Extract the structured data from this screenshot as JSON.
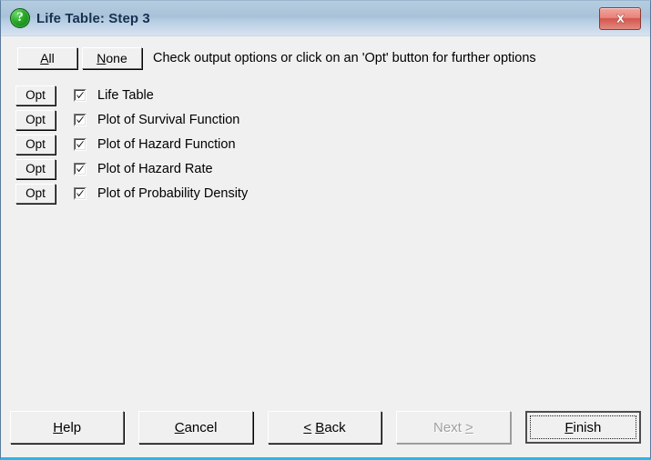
{
  "window": {
    "title": "Life Table: Step 3",
    "icon": "question-mark-icon",
    "close_label": "x",
    "accent_bottom": "#29b6e8",
    "titlebar_color": "#a9c2d9"
  },
  "toolbar": {
    "all_label": "All",
    "all_accel": "A",
    "none_label": "None",
    "none_accel": "N",
    "hint": "Check output options or click on an 'Opt' button for further options"
  },
  "options": {
    "opt_button_label": "Opt",
    "items": [
      {
        "label": "Life Table",
        "checked": true
      },
      {
        "label": "Plot of Survival Function",
        "checked": true
      },
      {
        "label": "Plot of Hazard Function",
        "checked": true
      },
      {
        "label": "Plot of Hazard Rate",
        "checked": true
      },
      {
        "label": "Plot of Probability Density",
        "checked": true
      }
    ]
  },
  "buttons": [
    {
      "label": "Help",
      "accel": "H",
      "disabled": false,
      "default": false
    },
    {
      "label": "Cancel",
      "accel": "C",
      "disabled": false,
      "default": false
    },
    {
      "label": "< Back",
      "accel": "B",
      "disabled": false,
      "default": false
    },
    {
      "label": "Next >",
      "accel": "N",
      "disabled": true,
      "default": false
    },
    {
      "label": "Finish",
      "accel": "F",
      "disabled": false,
      "default": true
    }
  ]
}
